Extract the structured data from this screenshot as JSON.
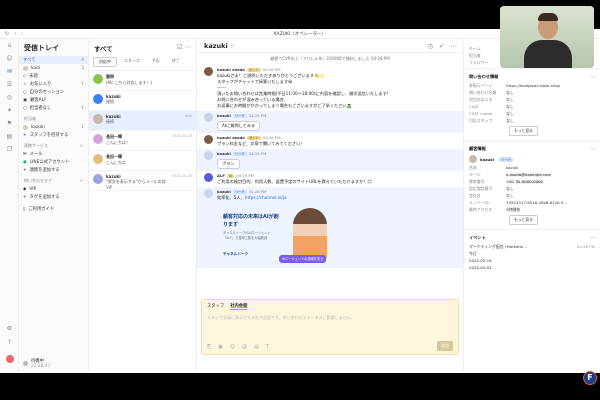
{
  "window": {
    "title": "KAZUKI（オペレーター）",
    "conversation_title": "kazuki"
  },
  "inbox": {
    "heading": "受信トレイ",
    "items": [
      {
        "label": "すべて",
        "count": "4"
      },
      {
        "label": "kadi",
        "count": "3"
      },
      {
        "label": "未読",
        "count": ""
      },
      {
        "label": "お気に入り",
        "count": "1"
      },
      {
        "label": "自分のセッション",
        "count": ""
      },
      {
        "label": "顧客ALF",
        "count": ""
      },
      {
        "label": "担当者なし",
        "count": "1"
      }
    ],
    "members_heading": "担当者",
    "members": [
      {
        "label": "kazuki",
        "count": "1"
      },
      {
        "label": "スタッフを招待する",
        "count": ""
      }
    ],
    "services_heading": "連携サービス",
    "services": [
      {
        "label": "メール"
      },
      {
        "label": "LINE公式アカウント"
      },
      {
        "label": "連携を追加する"
      }
    ],
    "tags_heading": "問い合わせタグ",
    "tags": [
      {
        "label": "VIP"
      },
      {
        "label": "タグを追加する"
      }
    ],
    "guide": "ご利用ガイド",
    "user": {
      "name": "待機中",
      "time": "22:28:47"
    }
  },
  "list": {
    "heading": "すべて",
    "tabs": [
      "対応中",
      "スヌーズ",
      "予告",
      "終了"
    ],
    "conversations": [
      {
        "name": "闖問",
        "message": "(Mc こちら対応します！)",
        "time": "",
        "avatar_color": "#8bc34a"
      },
      {
        "name": "kazuki",
        "message": "接続",
        "time": "",
        "avatar_color": "#3b82f6"
      },
      {
        "name": "kazuki",
        "message": "接続",
        "time": "kadi",
        "avatar_color": "#c9b8a6"
      },
      {
        "name": "長田一輝",
        "message": "こんにちは！",
        "time": "2024-10-29",
        "avatar_color": "#d6a5d6"
      },
      {
        "name": "長田一輝",
        "message": "こんにちは",
        "time": "",
        "avatar_color": "#e0c080"
      },
      {
        "name": "kazuki",
        "message": "\"原文を表示する\"からメールの詳細...",
        "time": "2024-10-28",
        "avatar_color": "#9aa4dd",
        "tag": "VIP"
      }
    ]
  },
  "chat": {
    "system": "顧客でCVR向上（アバレル系）230908で開封しました  04:28 PM",
    "messages": [
      {
        "author": "kazuki osada",
        "badge": "ボット",
        "time": "04:28 PM",
        "lines": [
          "kazukiさま！ご説明いただきありがとうございます👏✨",
          "スタッフがチャットで接客いたします😀",
          "------",
          "頂いたお問い合わせは営業時間(平日11:00〜18:00)に内容を確認し、順次返信いたします！",
          "お問い合わせが混み合っている場合、",
          "お返事にお時間がかかってしまう場合もございますがご了承ください🙇‍♂️"
        ],
        "kind": "bot"
      },
      {
        "author": "kazuki",
        "badge": "リード",
        "time": "04:28 PM",
        "bubble": "AIに質問してみる",
        "kind": "member"
      },
      {
        "author": "kazuki osada",
        "badge": "ボット",
        "time": "04:28 PM",
        "lines": [
          "プラン料金など、文章で聞いてみてください！"
        ],
        "kind": "bot"
      },
      {
        "author": "kazuki",
        "badge": "リード",
        "time": "04:28 PM",
        "bubble": "プラン",
        "kind": "member"
      },
      {
        "author": "ALF",
        "badge": "AI",
        "time": "04:29 PM",
        "lines": [
          "ご利用の検討目的、利用人数、設置予定のサイトURLを教えていただけますか？😊"
        ],
        "kind": "ai"
      },
      {
        "author": "kazuki",
        "badge": "リード",
        "time": "04:28 PM",
        "lines": [
          "効率化、5人、https://channel.io/ja"
        ],
        "kind": "member"
      }
    ],
    "banner": {
      "title": "顧客対応の未来はAIが創ります",
      "subtitle": "チャネルトークのAIエージェント「ALF」で運用工数を大幅削減",
      "brand": "チャネルトーク",
      "cta": "AIエージェントの詳細を見る"
    },
    "composer": {
      "tabs": [
        "スタッフ",
        "社内会話"
      ],
      "placeholder": "スタッフ全員に表示される社内会話です。問い合わせステータスに影響しません。",
      "send": "送信"
    }
  },
  "details": {
    "team_rows": [
      {
        "k": "チーム",
        "v": "なし"
      },
      {
        "k": "担当者",
        "v": "kadi"
      },
      {
        "k": "フォロワー",
        "v": "kadi"
      }
    ],
    "inquiry_heading": "問い合わせ情報",
    "inquiry_rows": [
      {
        "k": "参照元ページ",
        "v": "https://kadijapan.base.shop"
      },
      {
        "k": "問い合わせ分類",
        "v": "なし"
      },
      {
        "k": "初回対応メモ",
        "v": "なし"
      },
      {
        "k": "CSAT",
        "v": "なし"
      },
      {
        "k": "CSAT comm.",
        "v": "なし"
      },
      {
        "k": "対応スタッフ",
        "v": "なし"
      }
    ],
    "more": "もっと見る",
    "customer_heading": "顧客情報",
    "customer_name": "kazuki",
    "customer_badge": "リード",
    "customer_rows": [
      {
        "k": "名前",
        "v": "kazuki"
      },
      {
        "k": "メール",
        "v": "k.osada@example.com"
      },
      {
        "k": "携帯番号",
        "v": "+81 90-0000-0000"
      },
      {
        "k": "固定電話番号",
        "v": "なし"
      },
      {
        "k": "会社名",
        "v": "なし"
      },
      {
        "k": "メンバーID",
        "v": "33924317-8516-49e8-812b-5..."
      },
      {
        "k": "最終アクセス",
        "v": "3時間前"
      }
    ],
    "events_heading": "イベント",
    "events": [
      {
        "label": "マーケティング配信 (Marketin...",
        "time": "04:26 PM"
      },
      {
        "label": "今日",
        "time": ""
      },
      {
        "label": "2025-05-18",
        "time": ""
      },
      {
        "label": "2025-05-02",
        "time": ""
      }
    ]
  }
}
